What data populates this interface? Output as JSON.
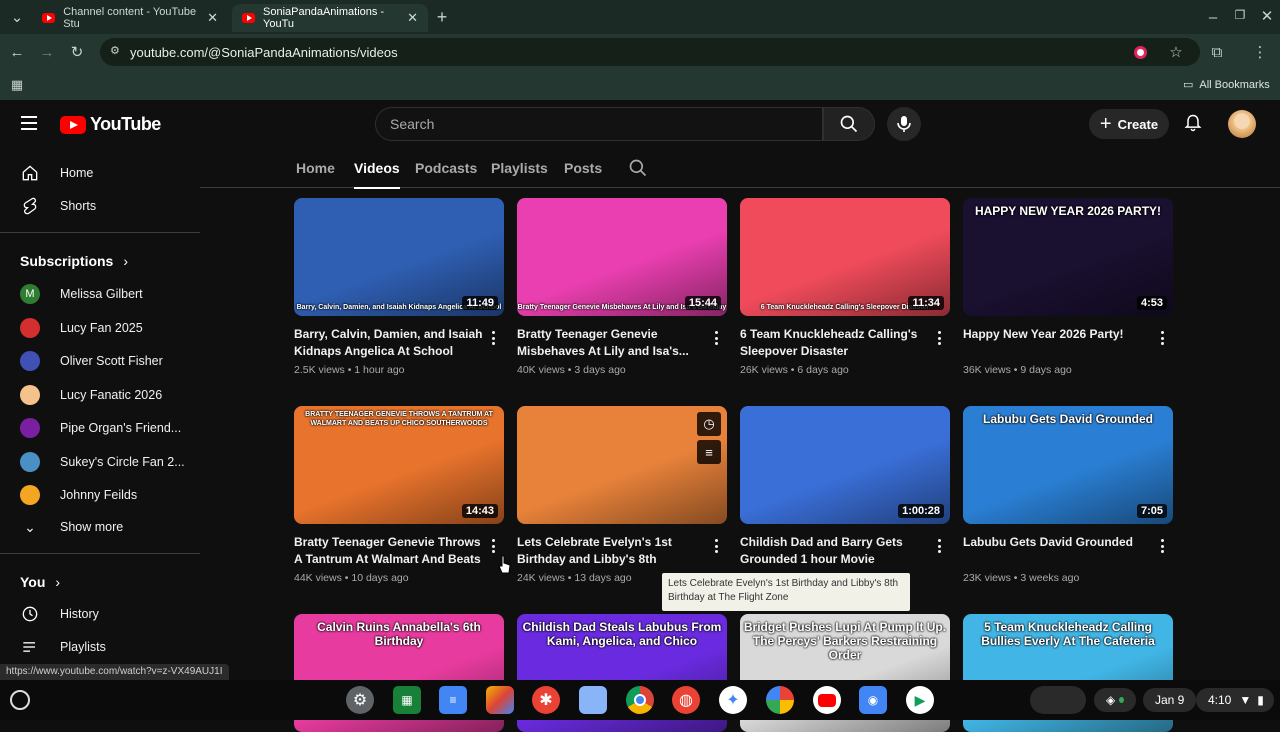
{
  "browser": {
    "tabs": [
      {
        "title": "Channel content - YouTube Stu",
        "active": false
      },
      {
        "title": "SoniaPandaAnimations - YouTu",
        "active": true
      }
    ],
    "url": "youtube.com/@SoniaPandaAnimations/videos",
    "all_bookmarks": "All Bookmarks"
  },
  "header": {
    "logo": "YouTube",
    "search_placeholder": "Search",
    "create_label": "Create"
  },
  "sidebar": {
    "main": [
      {
        "label": "Home",
        "icon": "home-icon"
      },
      {
        "label": "Shorts",
        "icon": "shorts-icon"
      }
    ],
    "subscriptions_title": "Subscriptions",
    "subscriptions": [
      {
        "label": "Melissa Gilbert",
        "initial": "M",
        "color": "#2e7d32"
      },
      {
        "label": "Lucy Fan 2025",
        "color": "#d32f2f"
      },
      {
        "label": "Oliver Scott Fisher",
        "color": "#3f51b5"
      },
      {
        "label": "Lucy Fanatic 2026",
        "color": "#f6c28b"
      },
      {
        "label": "Pipe Organ's Friend...",
        "color": "#7b1fa2"
      },
      {
        "label": "Sukey's Circle Fan 2...",
        "color": "#4a90c4"
      },
      {
        "label": "Johnny Feilds",
        "color": "#f4a623"
      }
    ],
    "show_more": "Show more",
    "you_title": "You",
    "you_items": [
      {
        "label": "History",
        "icon": "history-icon"
      },
      {
        "label": "Playlists",
        "icon": "playlists-icon"
      }
    ]
  },
  "channel_tabs": [
    {
      "label": "Home",
      "active": false
    },
    {
      "label": "Videos",
      "active": true
    },
    {
      "label": "Podcasts",
      "active": false
    },
    {
      "label": "Playlists",
      "active": false
    },
    {
      "label": "Posts",
      "active": false
    }
  ],
  "videos": [
    {
      "title": "Barry, Calvin, Damien, and Isaiah Kidnaps Angelica At School",
      "duration": "11:49",
      "views": "2.5K views",
      "age": "1 hour ago",
      "caption": "Barry, Calvin, Damien, and Isaiah Kidnaps Angelica At School",
      "bg": "#2f5fb3"
    },
    {
      "title": "Bratty Teenager Genevie Misbehaves At Lily and Isa's...",
      "duration": "15:44",
      "views": "40K views",
      "age": "3 days ago",
      "caption": "Bratty Teenager Genevie Misbehaves At Lily and Isa's Birthday",
      "bg": "#ea3fb0"
    },
    {
      "title": "6 Team Knuckleheadz Calling's Sleepover Disaster",
      "duration": "11:34",
      "views": "26K views",
      "age": "6 days ago",
      "caption": "6 Team Knuckleheadz Calling's Sleepover Disaster",
      "bg": "#ef4b5a"
    },
    {
      "title": "Happy New Year 2026 Party!",
      "duration": "4:53",
      "views": "36K views",
      "age": "9 days ago",
      "caption": "HAPPY NEW YEAR 2026 PARTY!",
      "bg": "#1a1030"
    },
    {
      "title": "Bratty Teenager Genevie Throws A Tantrum At Walmart And Beats Up...",
      "duration": "14:43",
      "views": "44K views",
      "age": "10 days ago",
      "caption": "BRATTY TEENAGER GENEVIE THROWS A TANTRUM AT WALMART AND BEATS UP CHICO SOUTHERWOODS",
      "bg": "#e8732c"
    },
    {
      "title": "Lets Celebrate Evelyn's 1st Birthday and Libby's 8th Birthday at The...",
      "duration": "",
      "views": "24K views",
      "age": "13 days ago",
      "caption": "",
      "bg": "#e8823a"
    },
    {
      "title": "Childish Dad and Barry Gets Grounded 1 hour Movie",
      "duration": "1:00:28",
      "views": "",
      "age": "",
      "caption": "",
      "bg": "#3a6fd8"
    },
    {
      "title": "Labubu Gets David Grounded",
      "duration": "7:05",
      "views": "23K views",
      "age": "3 weeks ago",
      "caption": "Labubu Gets David Grounded",
      "bg": "#2a7fd4"
    },
    {
      "title": "",
      "duration": "",
      "views": "",
      "age": "",
      "caption": "Calvin Ruins Annabella's 6th Birthday",
      "bg": "#e83b9f"
    },
    {
      "title": "",
      "duration": "",
      "views": "",
      "age": "",
      "caption": "Childish Dad Steals Labubus From Kami, Angelica, and Chico",
      "bg": "#6a2be0"
    },
    {
      "title": "",
      "duration": "",
      "views": "",
      "age": "",
      "caption": "Bridget Pushes Lupi At Pump It Up. The Percys' Barkers Restraining Order",
      "bg": "#d9d9d9"
    },
    {
      "title": "",
      "duration": "",
      "views": "",
      "age": "",
      "caption": "5 Team Knuckleheadz Calling Bullies Everly At The Cafeteria",
      "bg": "#41b6e6"
    }
  ],
  "tooltip": "Lets Celebrate Evelyn's 1st Birthday and Libby's 8th Birthday at The Flight Zone",
  "status_url": "https://www.youtube.com/watch?v=z-VX49AUJ1I",
  "shelf": {
    "date": "Jan 9",
    "time": "4:10"
  }
}
